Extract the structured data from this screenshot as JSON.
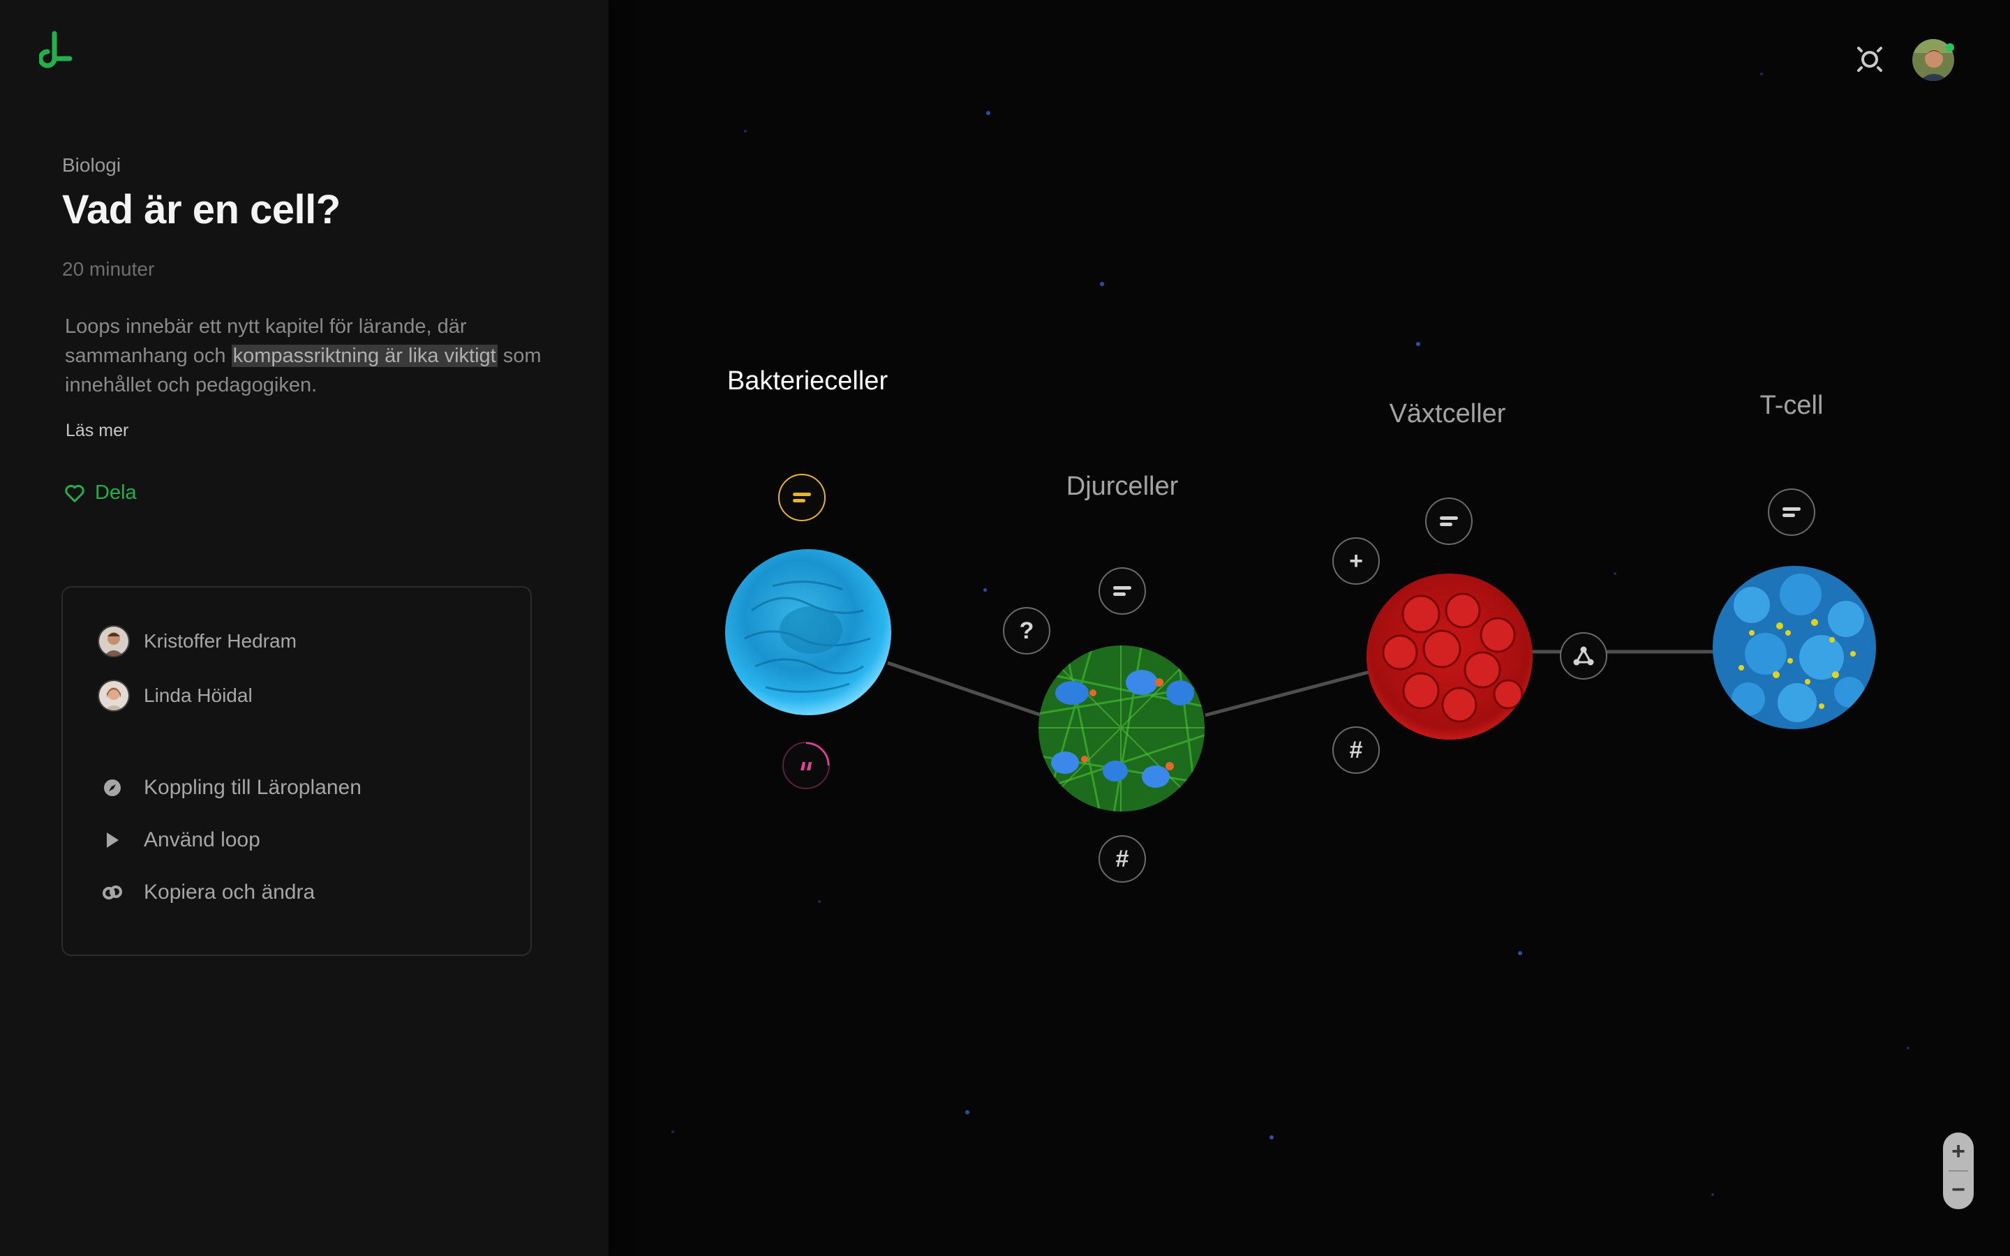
{
  "sidebar": {
    "subject": "Biologi",
    "title": "Vad är en cell?",
    "duration": "20 minuter",
    "description_before": "Loops innebär ett nytt kapitel för lärande, där sammanhang och ",
    "description_highlight": "kompassriktning är lika viktigt",
    "description_after": " som innehållet och pedagogiken.",
    "read_more": "Läs mer",
    "share": "Dela",
    "authors": [
      {
        "name": "Kristoffer Hedram"
      },
      {
        "name": "Linda Höidal"
      }
    ],
    "actions": [
      {
        "label": "Koppling till Läroplanen",
        "icon": "compass-icon"
      },
      {
        "label": "Använd loop",
        "icon": "play-icon"
      },
      {
        "label": "Kopiera och ändra",
        "icon": "link-icon"
      }
    ]
  },
  "map": {
    "nodes": [
      {
        "label": "Bakterieceller",
        "active": true
      },
      {
        "label": "Djurceller",
        "active": false
      },
      {
        "label": "Växtceller",
        "active": false
      },
      {
        "label": "T-cell",
        "active": false
      }
    ],
    "zoom_in": "+",
    "zoom_out": "−"
  },
  "icons": {
    "text": "text-lines-icon",
    "question": "question-icon",
    "hash": "hash-icon",
    "plus": "plus-icon",
    "quote": "quote-icon",
    "network": "network-icon",
    "settings": "sun-settings-icon"
  },
  "colors": {
    "accent_green": "#21b04b",
    "highlight_yellow": "#e7b52c",
    "quote_pink": "#e0449a",
    "link_line": "#5a5a5a",
    "online_dot": "#22c55e"
  }
}
